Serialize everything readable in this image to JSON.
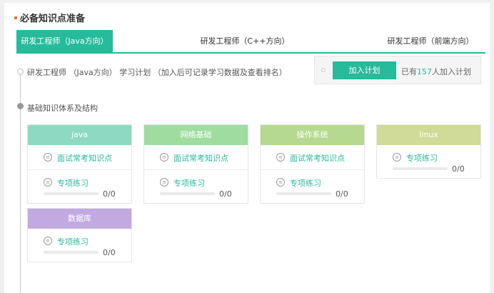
{
  "section": {
    "title": "必备知识点准备"
  },
  "tabs": [
    {
      "label": "研发工程师（Java方向）",
      "active": true
    },
    {
      "label": "研发工程师（C++方向）",
      "active": false
    },
    {
      "label": "研发工程师（前端方向）",
      "active": false
    }
  ],
  "plan": {
    "text": "研发工程师 （Java方向） 学习计划 （加入后可记录学习数据及查看排名）",
    "join_label": "加入计划",
    "joined_prefix": "已有",
    "joined_count": "157",
    "joined_suffix": "人加入计划"
  },
  "base": {
    "title": "基础知识体系及结构"
  },
  "colors": {
    "accent": "#25bb9b",
    "java": "#8dd9c1",
    "network": "#9edc9f",
    "os": "#b5da8f",
    "linux": "#cfdb96",
    "db": "#c2a9e2"
  },
  "cards": [
    {
      "name": "java",
      "interview": "面试常考知识点",
      "practice": "专项练习",
      "progress": "0/0"
    },
    {
      "name": "网络基础",
      "interview": "面试常考知识点",
      "practice": "专项练习",
      "progress": "0/0"
    },
    {
      "name": "操作系统",
      "interview": "面试常考知识点",
      "practice": "专项练习",
      "progress": "0/0"
    },
    {
      "name": "linux",
      "practice": "专项练习",
      "progress": "0/0"
    },
    {
      "name": "数据库",
      "practice": "专项练习",
      "progress": "0/0"
    }
  ]
}
